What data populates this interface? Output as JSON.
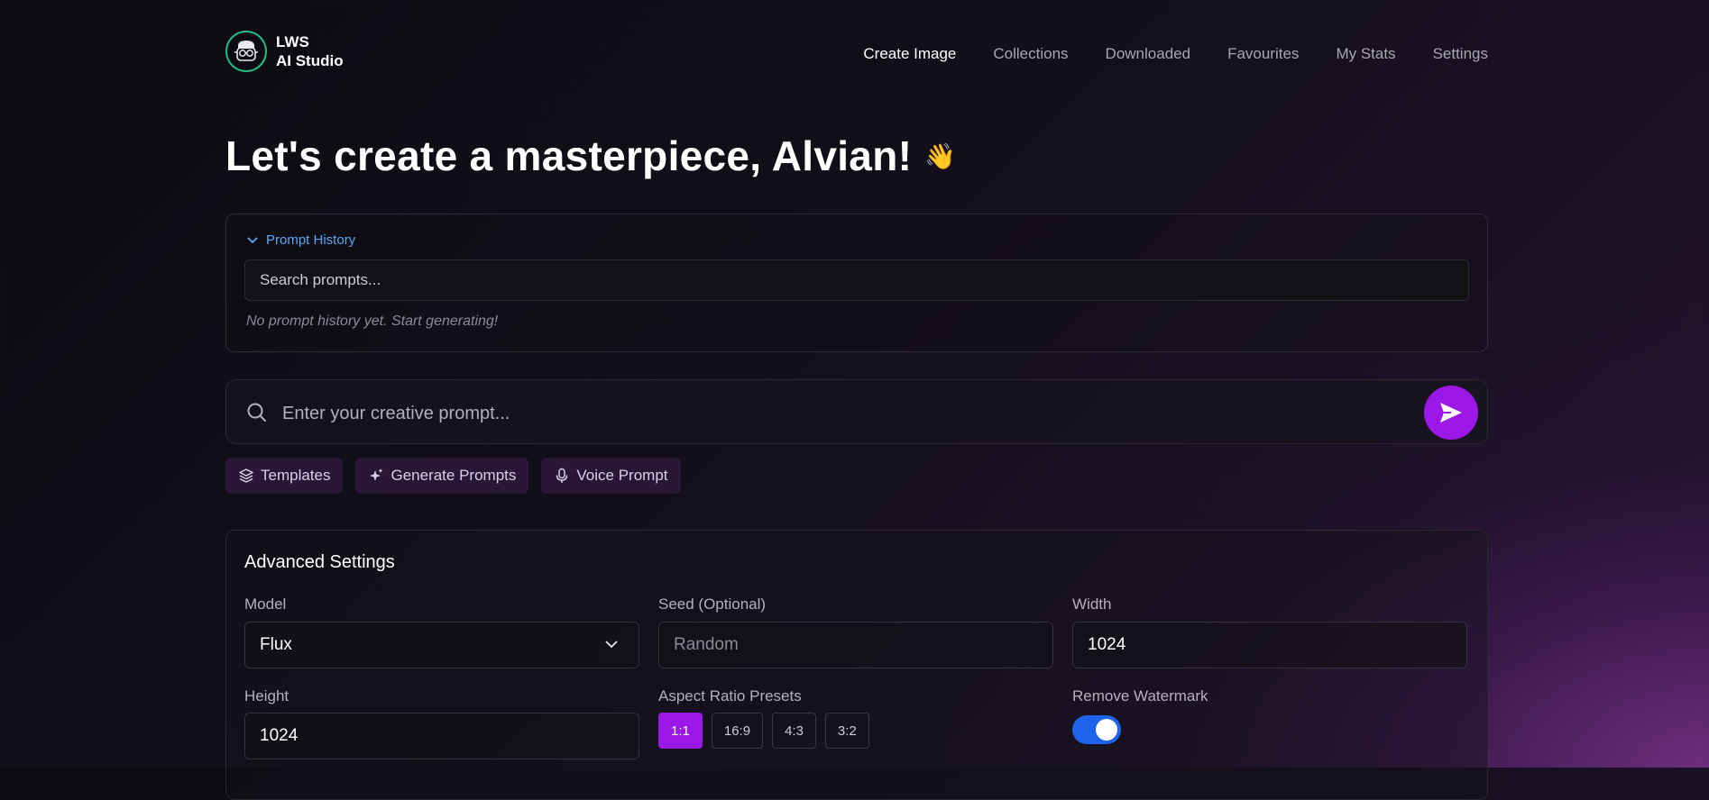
{
  "brand": {
    "line1": "LWS",
    "line2": "AI Studio",
    "logo_icon": "nerd-face-icon"
  },
  "nav": {
    "items": [
      {
        "label": "Create Image",
        "active": true
      },
      {
        "label": "Collections",
        "active": false
      },
      {
        "label": "Downloaded",
        "active": false
      },
      {
        "label": "Favourites",
        "active": false
      },
      {
        "label": "My Stats",
        "active": false
      },
      {
        "label": "Settings",
        "active": false
      }
    ]
  },
  "page": {
    "title": "Let's create a masterpiece, Alvian!",
    "title_emoji": "👋"
  },
  "history": {
    "toggle_label": "Prompt History",
    "search_placeholder": "Search prompts...",
    "empty_text": "No prompt history yet. Start generating!"
  },
  "prompt": {
    "placeholder": "Enter your creative prompt...",
    "send_icon": "send-icon"
  },
  "chips": [
    {
      "label": "Templates",
      "icon": "layers-icon"
    },
    {
      "label": "Generate Prompts",
      "icon": "sparkles-icon"
    },
    {
      "label": "Voice Prompt",
      "icon": "microphone-icon"
    }
  ],
  "advanced": {
    "title": "Advanced Settings",
    "model": {
      "label": "Model",
      "value": "Flux"
    },
    "seed": {
      "label": "Seed (Optional)",
      "placeholder": "Random"
    },
    "width": {
      "label": "Width",
      "value": "1024"
    },
    "height": {
      "label": "Height",
      "value": "1024"
    },
    "aspect": {
      "label": "Aspect Ratio Presets",
      "options": [
        "1:1",
        "16:9",
        "4:3",
        "3:2"
      ],
      "selected": "1:1"
    },
    "watermark": {
      "label": "Remove Watermark",
      "enabled": true
    }
  },
  "colors": {
    "accent": "#9b18e8",
    "link": "#5aa9f6",
    "toggle": "#1e63e9",
    "logo_ring": "#1fbf83"
  }
}
